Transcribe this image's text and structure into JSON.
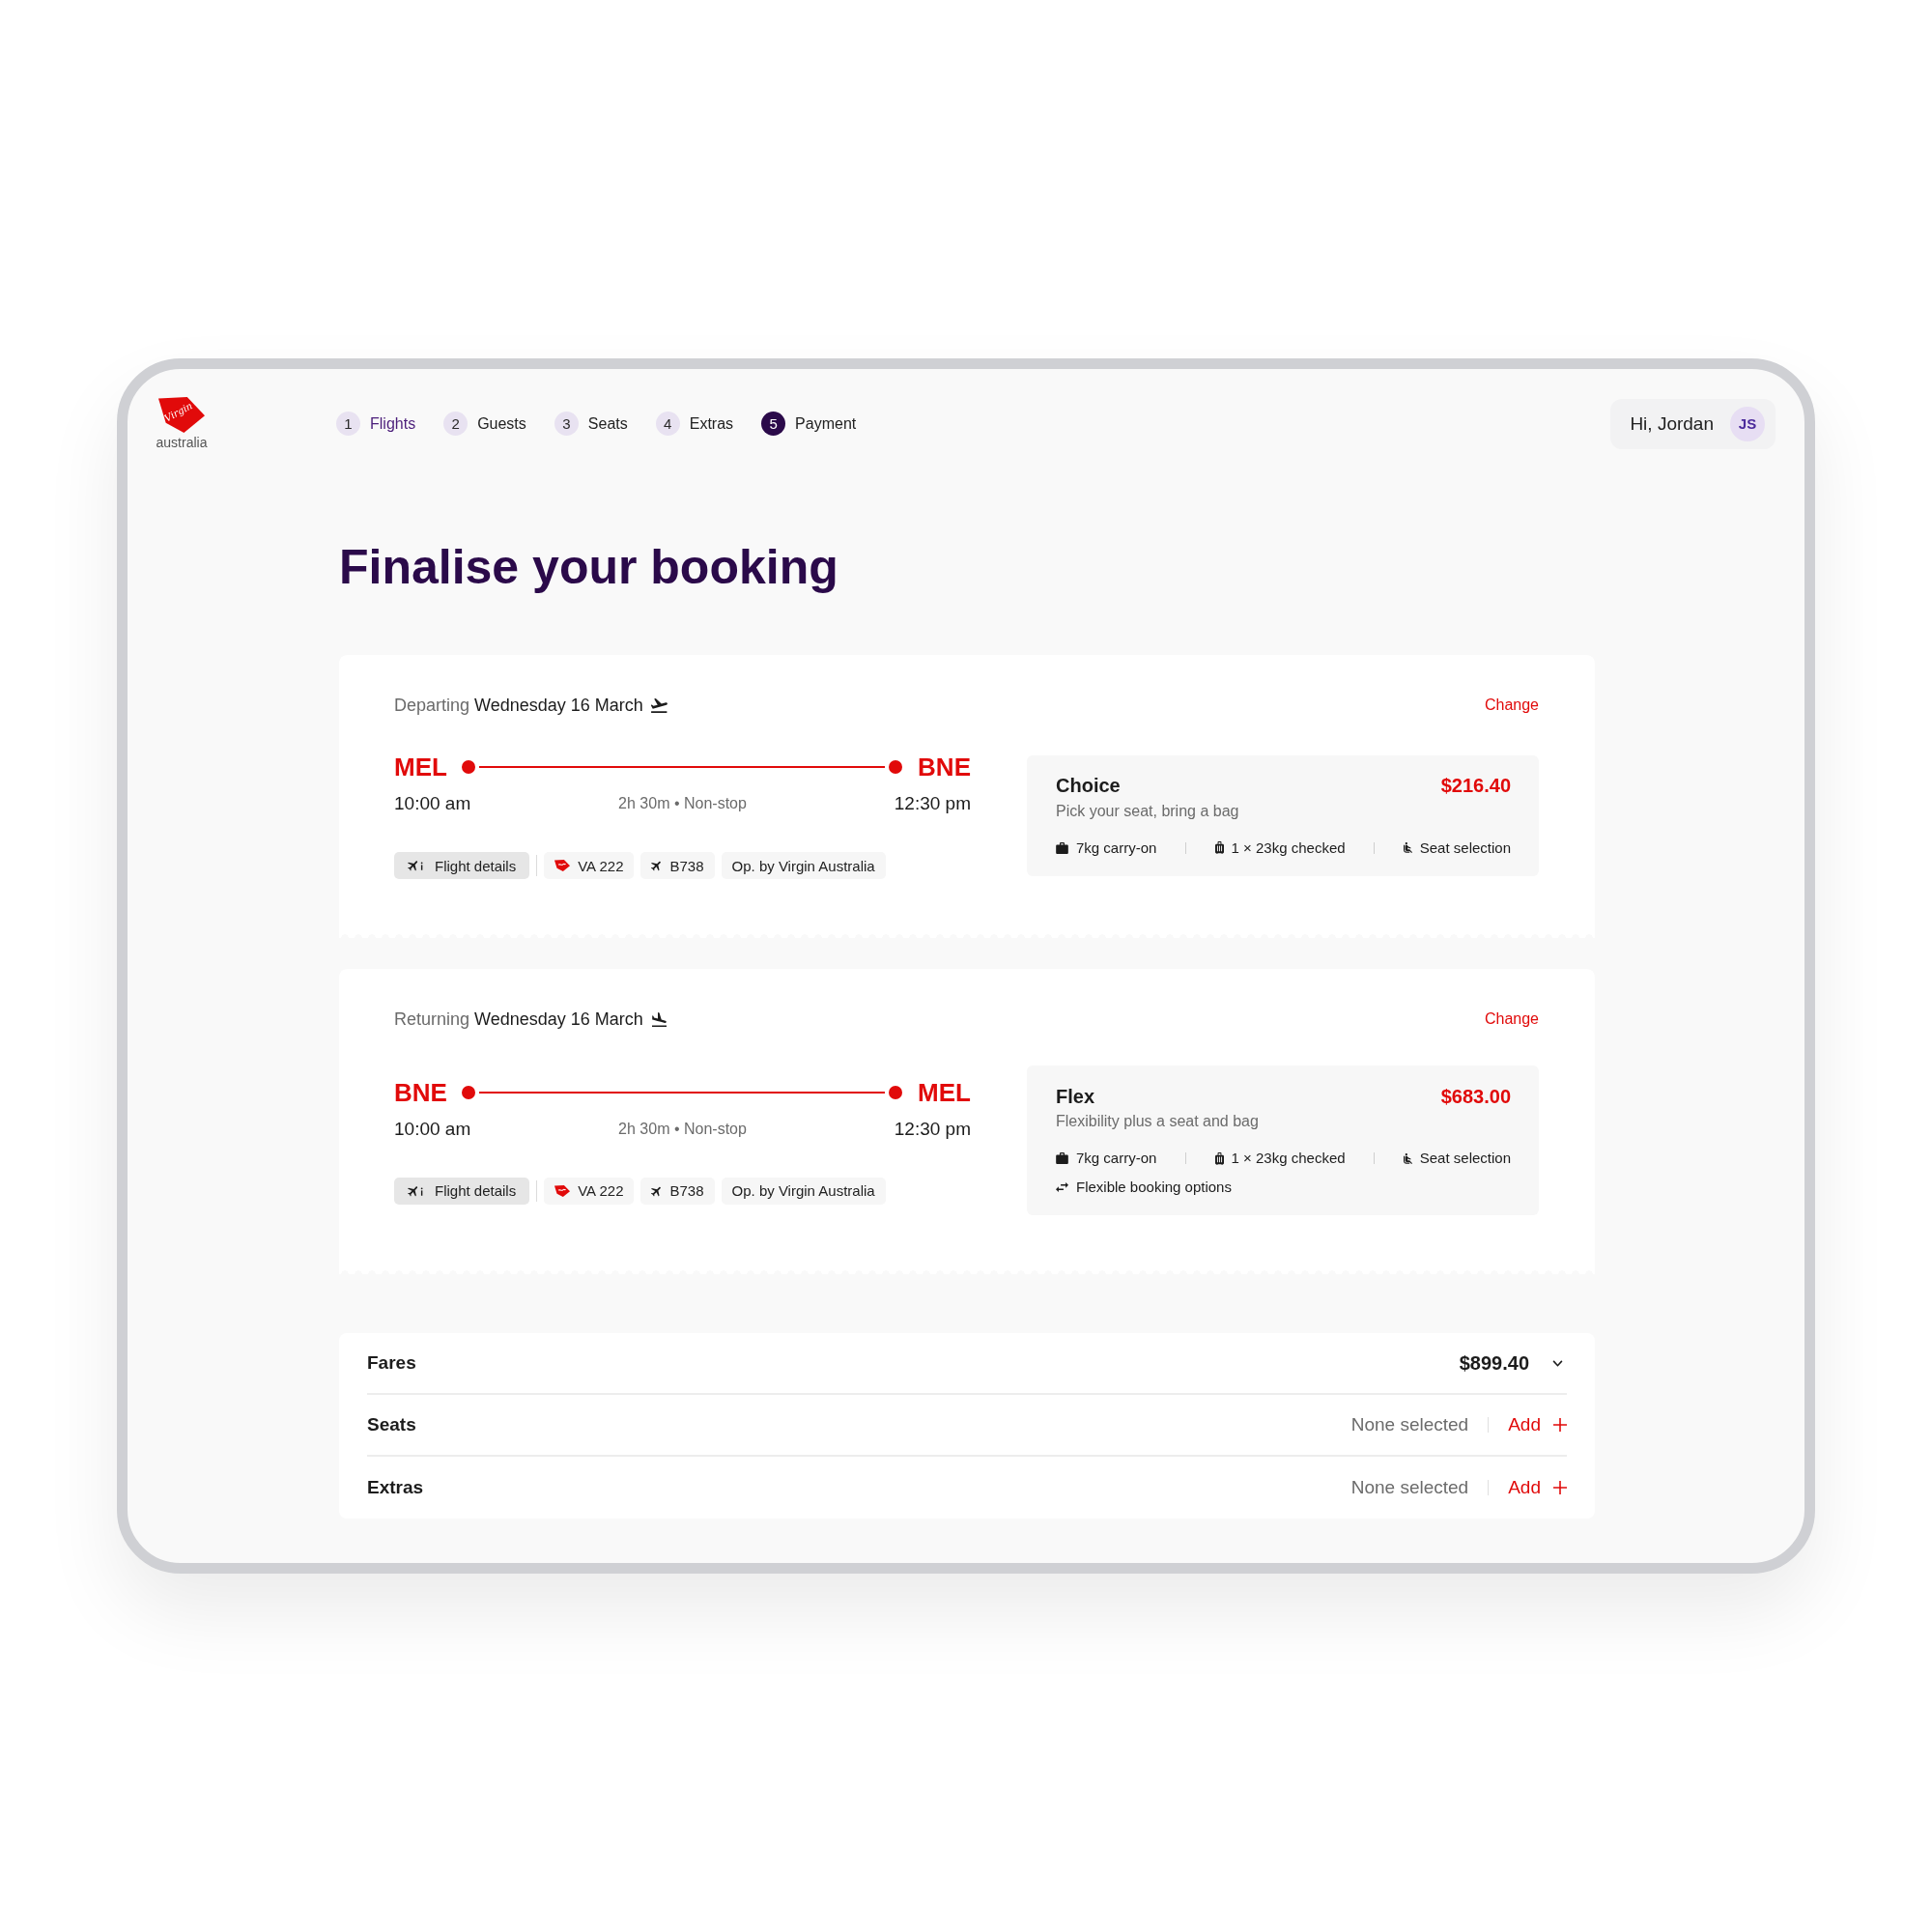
{
  "logo": {
    "script": "Virgin",
    "wordmark": "australia"
  },
  "steps": [
    {
      "number": "1",
      "label": "Flights",
      "selected": false,
      "visited": true
    },
    {
      "number": "2",
      "label": "Guests",
      "selected": false,
      "visited": false
    },
    {
      "number": "3",
      "label": "Seats",
      "selected": false,
      "visited": false
    },
    {
      "number": "4",
      "label": "Extras",
      "selected": false,
      "visited": false
    },
    {
      "number": "5",
      "label": "Payment",
      "selected": true,
      "visited": false
    }
  ],
  "user": {
    "greeting": "Hi, Jordan",
    "initials": "JS"
  },
  "title": "Finalise your booking",
  "flights": [
    {
      "kind": "departure",
      "direction": "Departing",
      "date": "Wednesday 16 March",
      "change": "Change",
      "origin": "MEL",
      "destination": "BNE",
      "depart_time": "10:00 am",
      "arrive_time": "12:30 pm",
      "duration": "2h 30m • Non-stop",
      "details": "Flight details",
      "flight_number": "VA 222",
      "aircraft": "B738",
      "operator": "Op. by Virgin Australia",
      "fare": {
        "name": "Choice",
        "price": "$216.40",
        "description": "Pick your seat, bring a bag",
        "features": [
          {
            "kind": "carry-on",
            "text": "7kg carry-on"
          },
          {
            "kind": "checked",
            "text": "1 × 23kg checked"
          },
          {
            "kind": "seat",
            "text": "Seat selection"
          }
        ]
      }
    },
    {
      "kind": "arrival",
      "direction": "Returning",
      "date": "Wednesday 16 March",
      "change": "Change",
      "origin": "BNE",
      "destination": "MEL",
      "depart_time": "10:00 am",
      "arrive_time": "12:30 pm",
      "duration": "2h 30m • Non-stop",
      "details": "Flight details",
      "flight_number": "VA 222",
      "aircraft": "B738",
      "operator": "Op. by Virgin Australia",
      "fare": {
        "name": "Flex",
        "price": "$683.00",
        "description": "Flexibility plus a seat and bag",
        "features": [
          {
            "kind": "carry-on",
            "text": "7kg carry-on"
          },
          {
            "kind": "checked",
            "text": "1 × 23kg checked"
          },
          {
            "kind": "seat",
            "text": "Seat selection"
          },
          {
            "kind": "flexible",
            "text": "Flexible booking options"
          }
        ]
      }
    }
  ],
  "summary": [
    {
      "kind": "total",
      "label": "Fares",
      "value": "$899.40"
    },
    {
      "kind": "add",
      "label": "Seats",
      "status": "None selected",
      "action": "Add"
    },
    {
      "kind": "add",
      "label": "Extras",
      "status": "None selected",
      "action": "Add"
    }
  ]
}
